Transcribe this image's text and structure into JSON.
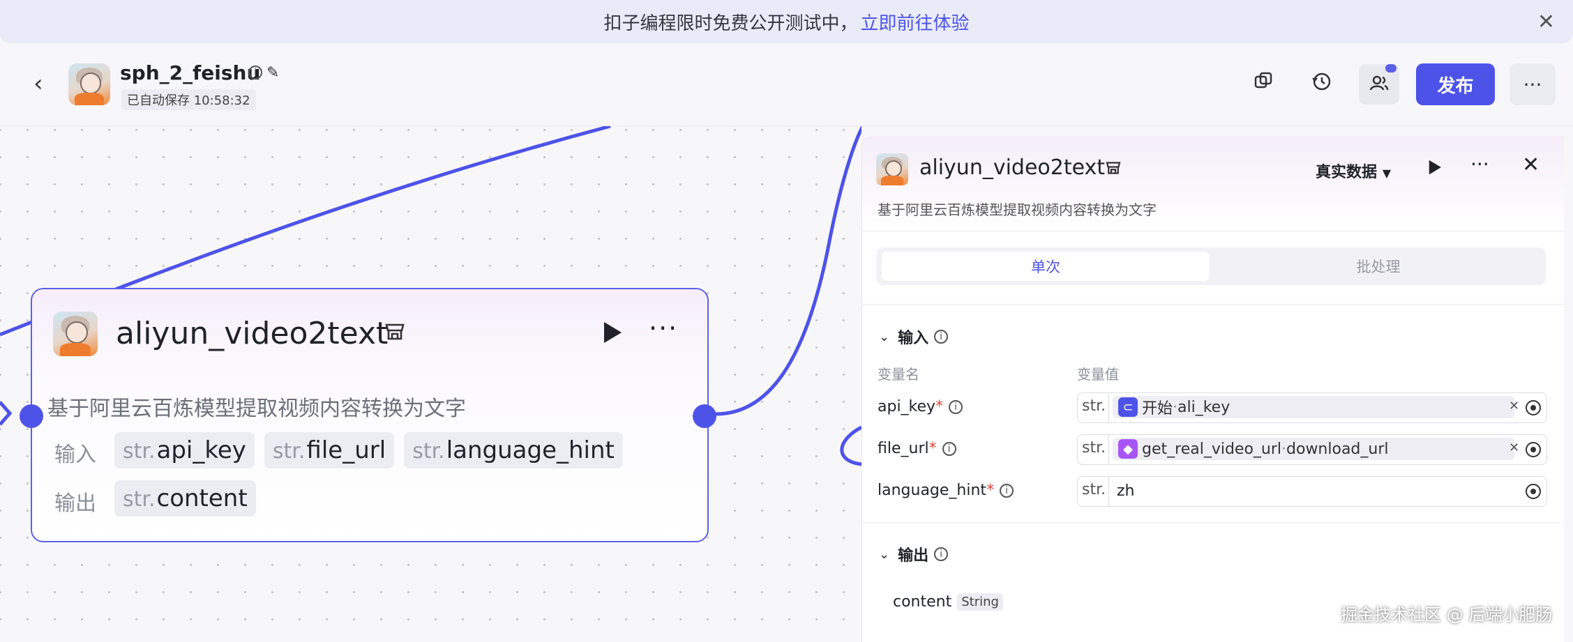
{
  "banner": {
    "text": "扣子编程限时免费公开测试中，",
    "link": "立即前往体验",
    "close_icon": "close-icon"
  },
  "header": {
    "app_name": "sph_2_feishu",
    "autosave": "已自动保存 10:58:32",
    "publish_label": "发布",
    "more_label": "···",
    "icons": [
      "back-icon",
      "info-icon",
      "edit-icon",
      "copy-icon",
      "history-icon",
      "invite-users-icon",
      "more-icon"
    ],
    "accent": "#4d53e8"
  },
  "node": {
    "title": "aliyun_video2text",
    "description": "基于阿里云百炼模型提取视频内容转换为文字",
    "input_label": "输入",
    "output_label": "输出",
    "inputs": [
      {
        "type": "str.",
        "name": "api_key"
      },
      {
        "type": "str.",
        "name": "file_url"
      },
      {
        "type": "str.",
        "name": "language_hint"
      }
    ],
    "outputs": [
      {
        "type": "str.",
        "name": "content"
      }
    ],
    "run_icon": "play-icon",
    "more_label": "···"
  },
  "panel": {
    "title": "aliyun_video2text",
    "description": "基于阿里云百炼模型提取视频内容转换为文字",
    "mode_label": "真实数据",
    "tabs": [
      {
        "label": "单次",
        "active": true
      },
      {
        "label": "批处理",
        "active": false
      }
    ],
    "input_section": "输入",
    "col_name": "变量名",
    "col_value": "变量值",
    "params": [
      {
        "name": "api_key",
        "required": "*",
        "type": "str.",
        "ref_source": "开始",
        "ref_sep": " · ",
        "ref_field": "ali_key",
        "icon_color": "#4d53e8"
      },
      {
        "name": "file_url",
        "required": "*",
        "type": "str.",
        "ref_source": "get_real_video_url",
        "ref_sep": " · ",
        "ref_field": "download_url",
        "icon_color": "#a855f7"
      },
      {
        "name": "language_hint",
        "required": "*",
        "type": "str.",
        "value": "zh"
      }
    ],
    "output_section": "输出",
    "outputs": [
      {
        "name": "content",
        "type": "String"
      }
    ],
    "more_label": "···"
  },
  "watermark": "掘金技术社区 @ 后端小肥肠"
}
